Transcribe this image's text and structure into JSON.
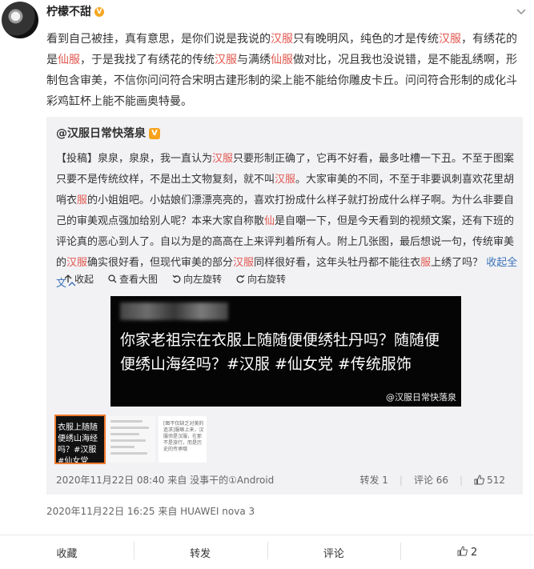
{
  "post": {
    "username": "柠檬不甜",
    "verified_badge": "V",
    "more_icon": "chevron-down-icon",
    "text_segments": [
      {
        "t": "看到自己被挂，真有意思，是你们说是我说的"
      },
      {
        "t": "汉服",
        "hl": true
      },
      {
        "t": "只有晚明风，纯色的才是传统"
      },
      {
        "t": "汉服",
        "hl": true
      },
      {
        "t": "，有绣花的是"
      },
      {
        "t": "仙服",
        "hl": true
      },
      {
        "t": "，于是我找了有绣花的传统"
      },
      {
        "t": "汉服",
        "hl": true
      },
      {
        "t": "与满绣"
      },
      {
        "t": "仙服",
        "hl": true
      },
      {
        "t": "做对比，况且我也没说错，是不能乱绣啊，形制包含审美，不信你问问符合宋明古建形制的梁上能不能给你雕皮卡丘。问问符合形制的成化斗彩鸡缸杯上能不能画奥特曼。"
      }
    ],
    "timestamp": "2020年11月22日 16:25",
    "source": "来自 HUAWEI nova 3"
  },
  "repost": {
    "author": "@汉服日常快落泉",
    "verified_badge": "V",
    "text_segments": [
      {
        "t": "【投稿】泉泉，泉泉，我一直认为"
      },
      {
        "t": "汉服",
        "hl": true
      },
      {
        "t": "只要形制正确了，它再不好看，最多吐槽一下丑。不至于图案只要不是传统纹样，不是出土文物复刻，就不叫"
      },
      {
        "t": "汉服",
        "hl": true
      },
      {
        "t": "。大家审美的不同，不至于非要讽刺喜欢花里胡哨衣"
      },
      {
        "t": "服",
        "hl": true
      },
      {
        "t": "的小姐姐吧。小姑娘们漂漂亮亮的，喜欢打扮成什么样子就打扮成什么样子啊。为什么非要自己的审美观点强加给别人呢？本来大家自称散"
      },
      {
        "t": "仙",
        "hl": true
      },
      {
        "t": "是自嘲一下，但是今天看到的视频文案，还有下班的评论真的恶心到人了。自以为是的高高在上来评判着所有人。附上几张图，最后想说一句，传统审美的"
      },
      {
        "t": "汉服",
        "hl": true
      },
      {
        "t": "确实很好看，但现代审美的部分"
      },
      {
        "t": "汉服",
        "hl": true
      },
      {
        "t": "同样很好看，这年头牡丹都不能往衣"
      },
      {
        "t": "服",
        "hl": true
      },
      {
        "t": "上绣了吗？"
      }
    ],
    "collapse_link": "收起全文",
    "toolbar": {
      "collapse": "收起",
      "view_large": "查看大图",
      "rotate_left": "向左旋转",
      "rotate_right": "向右旋转"
    },
    "image": {
      "caption": "你家老祖宗在衣服上随随便便绣牡丹吗？随随便便绣山海经吗？#汉服 #仙女党 #传统服饰",
      "watermark": "@汉服日常快落泉"
    },
    "thumbnails": {
      "thumb1_text": "衣服上随随便绣山海经吗？#汉服 #仙女党",
      "thumb3_text": "[图不仅缺乏对美的追求]服嘛上来，汉服须是汉服，在那不是旅行，而是历史的传承哦"
    },
    "timestamp": "2020年11月22日 08:40",
    "source": "来自 没事干的①Android",
    "stats": {
      "repost": "转发 1",
      "comment": "评论 66",
      "likes": "512"
    }
  },
  "footer": {
    "favorite": "收藏",
    "repost": "转发",
    "comment": "评论",
    "likes": "2"
  },
  "colors": {
    "highlight": "#e2564e",
    "link": "#3b73b7",
    "repost_bg": "#f2f2f5",
    "thumb_active": "#f07b2e"
  }
}
